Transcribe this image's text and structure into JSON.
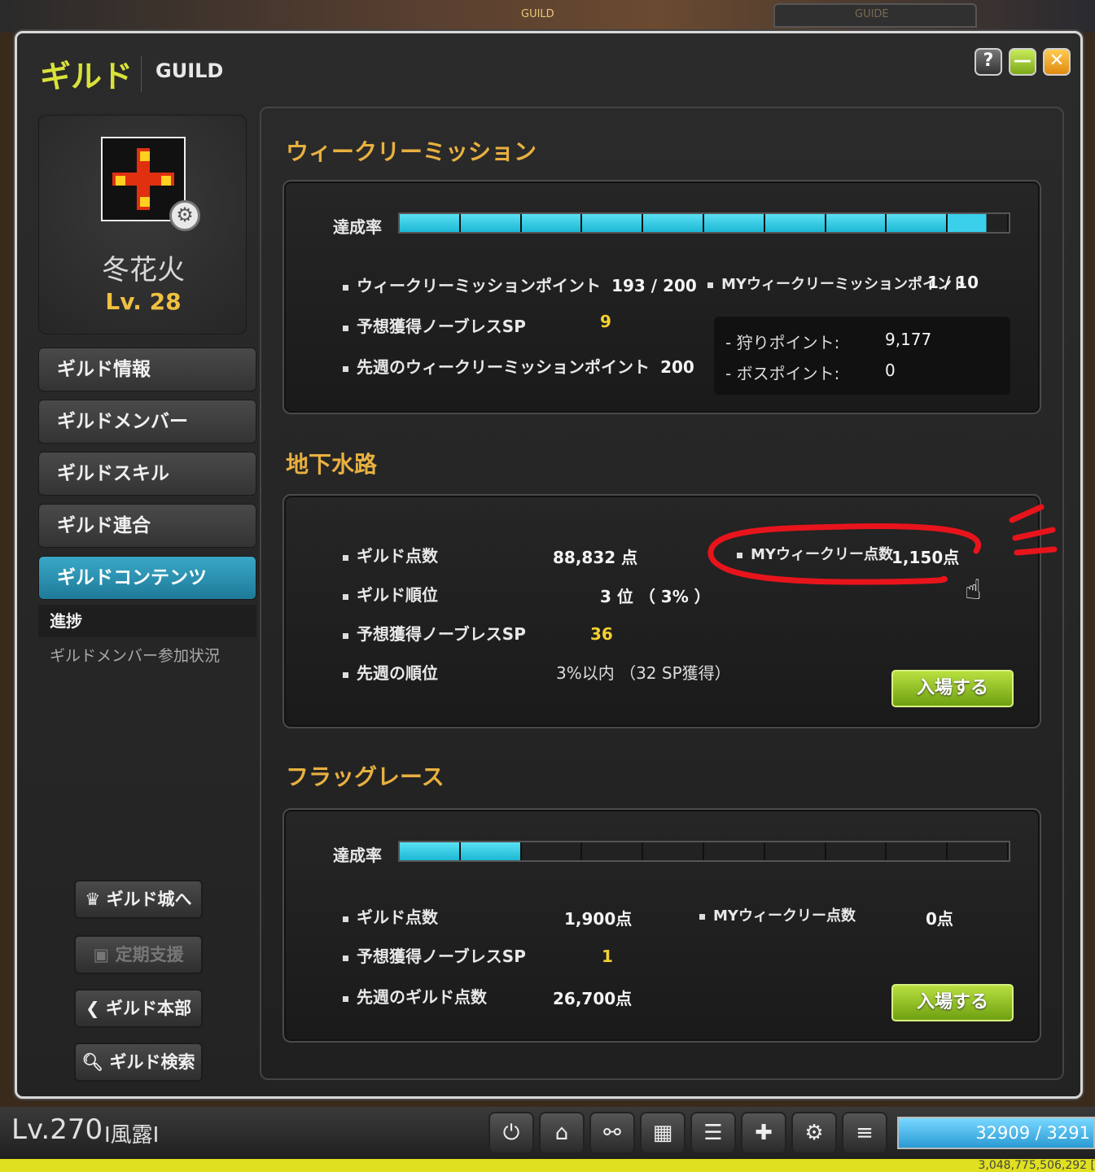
{
  "top_strip": {
    "tab_guild": "GUILD",
    "tab_guide": "GUIDE"
  },
  "window": {
    "title_jp": "ギルド",
    "title_en": "GUILD",
    "buttons": {
      "help": "?",
      "minimize": "—",
      "close": "✕"
    }
  },
  "sidebar": {
    "guild_name": "冬花火",
    "guild_level": "Lv. 28",
    "nav": [
      {
        "label": "ギルド情報"
      },
      {
        "label": "ギルドメンバー"
      },
      {
        "label": "ギルドスキル"
      },
      {
        "label": "ギルド連合"
      },
      {
        "label": "ギルドコンテンツ"
      }
    ],
    "progress_header": "進捗",
    "progress_item": "ギルドメンバー参加状況",
    "buttons": [
      {
        "label": "ギルド城へ",
        "icon": "castle-icon"
      },
      {
        "label": "定期支援",
        "icon": "support-icon"
      },
      {
        "label": "ギルド本部",
        "icon": "back-icon"
      },
      {
        "label": "ギルド検索",
        "icon": "search-icon"
      }
    ]
  },
  "weekly_mission": {
    "title": "ウィークリーミッション",
    "rate_label": "達成率",
    "rate_fraction": 0.965,
    "points_label": "ウィークリーミッションポイント",
    "points_value": "193 / 200",
    "expected_sp_label": "予想獲得ノーブレスSP",
    "expected_sp_value": "9",
    "last_week_label": "先週のウィークリーミッションポイント",
    "last_week_value": "200",
    "my_points_label": "MYウィークリーミッションポイント",
    "my_points_value": "1 / 10",
    "hunt_label": "- 狩りポイント:",
    "hunt_value": "9,177",
    "boss_label": "- ボスポイント:",
    "boss_value": "0"
  },
  "underground": {
    "title": "地下水路",
    "guild_score_label": "ギルド点数",
    "guild_score_value": "88,832 点",
    "rank_label": "ギルド順位",
    "rank_value": "3 位 （ 3% ）",
    "expected_sp_label": "予想獲得ノーブレスSP",
    "expected_sp_value": "36",
    "last_rank_label": "先週の順位",
    "last_rank_value": "3%以内 （32 SP獲得）",
    "my_weekly_label": "MYウィークリー点数",
    "my_weekly_value": "1,150点",
    "enter_label": "入場する"
  },
  "flag_race": {
    "title": "フラッグレース",
    "rate_label": "達成率",
    "rate_fraction": 0.2,
    "guild_score_label": "ギルド点数",
    "guild_score_value": "1,900点",
    "expected_sp_label": "予想獲得ノーブレスSP",
    "expected_sp_value": "1",
    "last_score_label": "先週のギルド点数",
    "last_score_value": "26,700点",
    "my_weekly_label": "MYウィークリー点数",
    "my_weekly_value": "0点",
    "enter_label": "入場する"
  },
  "bottom_bar": {
    "level": "Lv.270",
    "character_name": "I風露I",
    "hp": "32909 / 3291",
    "exp": "3,048,775,506,292 [",
    "icons": [
      "power-icon",
      "home-icon",
      "link-icon",
      "calendar-icon",
      "list-icon",
      "gift-icon",
      "settings-icon",
      "menu-icon"
    ]
  }
}
